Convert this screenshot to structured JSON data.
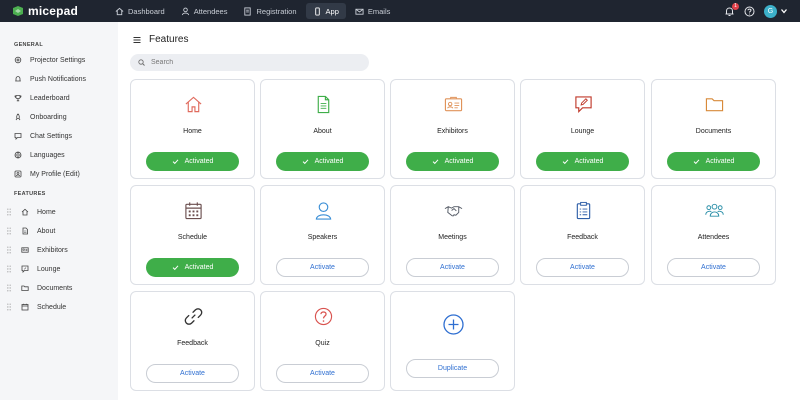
{
  "app": {
    "name": "micepad"
  },
  "nav": {
    "items": [
      {
        "label": "Dashboard",
        "icon": "home-icon"
      },
      {
        "label": "Attendees",
        "icon": "user-icon"
      },
      {
        "label": "Registration",
        "icon": "form-icon"
      },
      {
        "label": "App",
        "icon": "phone-icon",
        "active": true
      },
      {
        "label": "Emails",
        "icon": "mail-icon"
      }
    ],
    "notification_count": "1",
    "avatar_initial": "G"
  },
  "sidebar": {
    "general_heading": "GENERAL",
    "general_items": [
      {
        "label": "Projector Settings",
        "icon": "gear-icon"
      },
      {
        "label": "Push Notifications",
        "icon": "bell-icon"
      },
      {
        "label": "Leaderboard",
        "icon": "trophy-icon"
      },
      {
        "label": "Onboarding",
        "icon": "rocket-icon"
      },
      {
        "label": "Chat Settings",
        "icon": "chat-icon"
      },
      {
        "label": "Languages",
        "icon": "globe-icon"
      },
      {
        "label": "My Profile (Edit)",
        "icon": "profile-icon"
      }
    ],
    "features_heading": "FEATURES",
    "feature_items": [
      {
        "label": "Home",
        "icon": "home-icon"
      },
      {
        "label": "About",
        "icon": "document-icon"
      },
      {
        "label": "Exhibitors",
        "icon": "id-card-icon"
      },
      {
        "label": "Lounge",
        "icon": "chat-edit-icon"
      },
      {
        "label": "Documents",
        "icon": "folder-icon"
      },
      {
        "label": "Schedule",
        "icon": "calendar-icon"
      }
    ]
  },
  "main": {
    "title": "Features",
    "search_placeholder": "Search",
    "cards": [
      {
        "title": "Home",
        "button": "Activated",
        "state": "activated",
        "icon": "home-icon",
        "color": "#e06b5e"
      },
      {
        "title": "About",
        "button": "Activated",
        "state": "activated",
        "icon": "document-icon",
        "color": "#3fae49"
      },
      {
        "title": "Exhibitors",
        "button": "Activated",
        "state": "activated",
        "icon": "id-card-icon",
        "color": "#e0935a"
      },
      {
        "title": "Lounge",
        "button": "Activated",
        "state": "activated",
        "icon": "chat-edit-icon",
        "color": "#c0392b"
      },
      {
        "title": "Documents",
        "button": "Activated",
        "state": "activated",
        "icon": "folder-icon",
        "color": "#d88a3a"
      },
      {
        "title": "Schedule",
        "button": "Activated",
        "state": "activated",
        "icon": "calendar-icon",
        "color": "#6b4f4f"
      },
      {
        "title": "Speakers",
        "button": "Activate",
        "state": "inactive",
        "icon": "person-icon",
        "color": "#3b8fd6"
      },
      {
        "title": "Meetings",
        "button": "Activate",
        "state": "inactive",
        "icon": "handshake-icon",
        "color": "#555b66"
      },
      {
        "title": "Feedback",
        "button": "Activate",
        "state": "inactive",
        "icon": "clipboard-icon",
        "color": "#2f5fa8"
      },
      {
        "title": "Attendees",
        "button": "Activate",
        "state": "inactive",
        "icon": "group-icon",
        "color": "#2a8fa8"
      },
      {
        "title": "Feedback",
        "button": "Activate",
        "state": "inactive",
        "icon": "link-icon",
        "color": "#333333"
      },
      {
        "title": "Quiz",
        "button": "Activate",
        "state": "inactive",
        "icon": "question-icon",
        "color": "#d9534f"
      },
      {
        "title": "",
        "button": "Duplicate",
        "state": "inactive",
        "icon": "plus-circle-icon",
        "color": "#2f6fd1"
      }
    ]
  },
  "colors": {
    "topbar": "#1f2530",
    "activated": "#3fae49",
    "link": "#2f6fd1"
  }
}
